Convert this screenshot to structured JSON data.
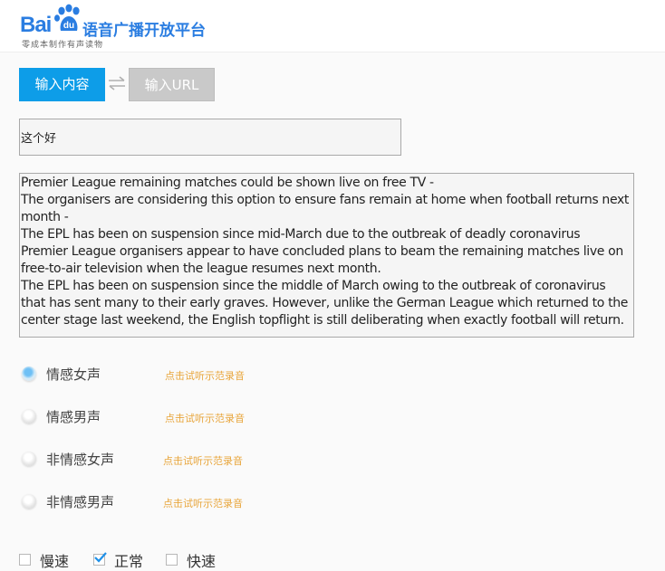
{
  "header": {
    "logo_text": "Bai",
    "logo_paw_text": "du",
    "product_name": "语音广播开放平台",
    "slogan": "零成本制作有声读物"
  },
  "tabs": {
    "input_content": "输入内容",
    "input_url": "输入URL"
  },
  "filename_value": "这个好",
  "content_value": "Premier League remaining matches could be shown live on free TV -\nThe organisers are considering this option to ensure fans remain at home when football returns next month -\nThe EPL has been on suspension since mid-March due to the outbreak of deadly coronavirus\nPremier League organisers appear to have concluded plans to beam the remaining matches live on free-to-air television when the league resumes next month.\nThe EPL has been on suspension since the middle of March owing to the outbreak of coronavirus that has sent many to their early graves. However, unlike the German League which returned to the center stage last weekend, the English topflight is still deliberating when exactly football will return.",
  "voices": [
    {
      "label": "情感女声",
      "demo": "点击试听示范录音",
      "selected": true
    },
    {
      "label": "情感男声",
      "demo": "点击试听示范录音",
      "selected": false
    },
    {
      "label": "非情感女声",
      "demo": "点击试听示范录音",
      "selected": false
    },
    {
      "label": "非情感男声",
      "demo": "点击试听示范录音",
      "selected": false
    }
  ],
  "speed": {
    "slow": "慢速",
    "normal": "正常",
    "fast": "快速",
    "selected": "normal"
  },
  "colors": {
    "brand_blue": "#2a7de1",
    "active_tab": "#0d9de8",
    "inactive_tab": "#c9c9c9",
    "demo_link": "#e8a53b"
  }
}
